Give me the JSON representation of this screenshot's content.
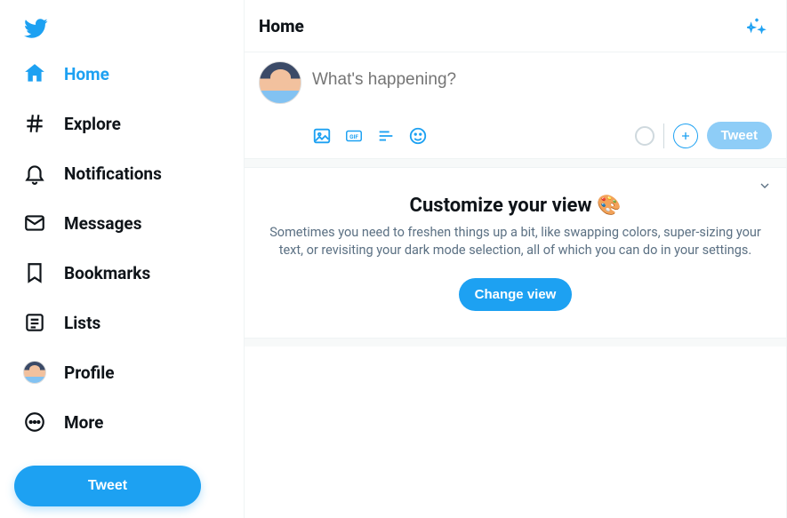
{
  "sidebar": {
    "nav": [
      {
        "label": "Home"
      },
      {
        "label": "Explore"
      },
      {
        "label": "Notifications"
      },
      {
        "label": "Messages"
      },
      {
        "label": "Bookmarks"
      },
      {
        "label": "Lists"
      },
      {
        "label": "Profile"
      },
      {
        "label": "More"
      }
    ],
    "tweet_button": "Tweet"
  },
  "header": {
    "title": "Home"
  },
  "composer": {
    "placeholder": "What's happening?",
    "tweet_button": "Tweet"
  },
  "customize": {
    "title": "Customize your view 🎨",
    "description": "Sometimes you need to freshen things up a bit, like swapping colors, super-sizing your text, or revisiting your dark mode selection, all of which you can do in your settings.",
    "button": "Change view"
  }
}
